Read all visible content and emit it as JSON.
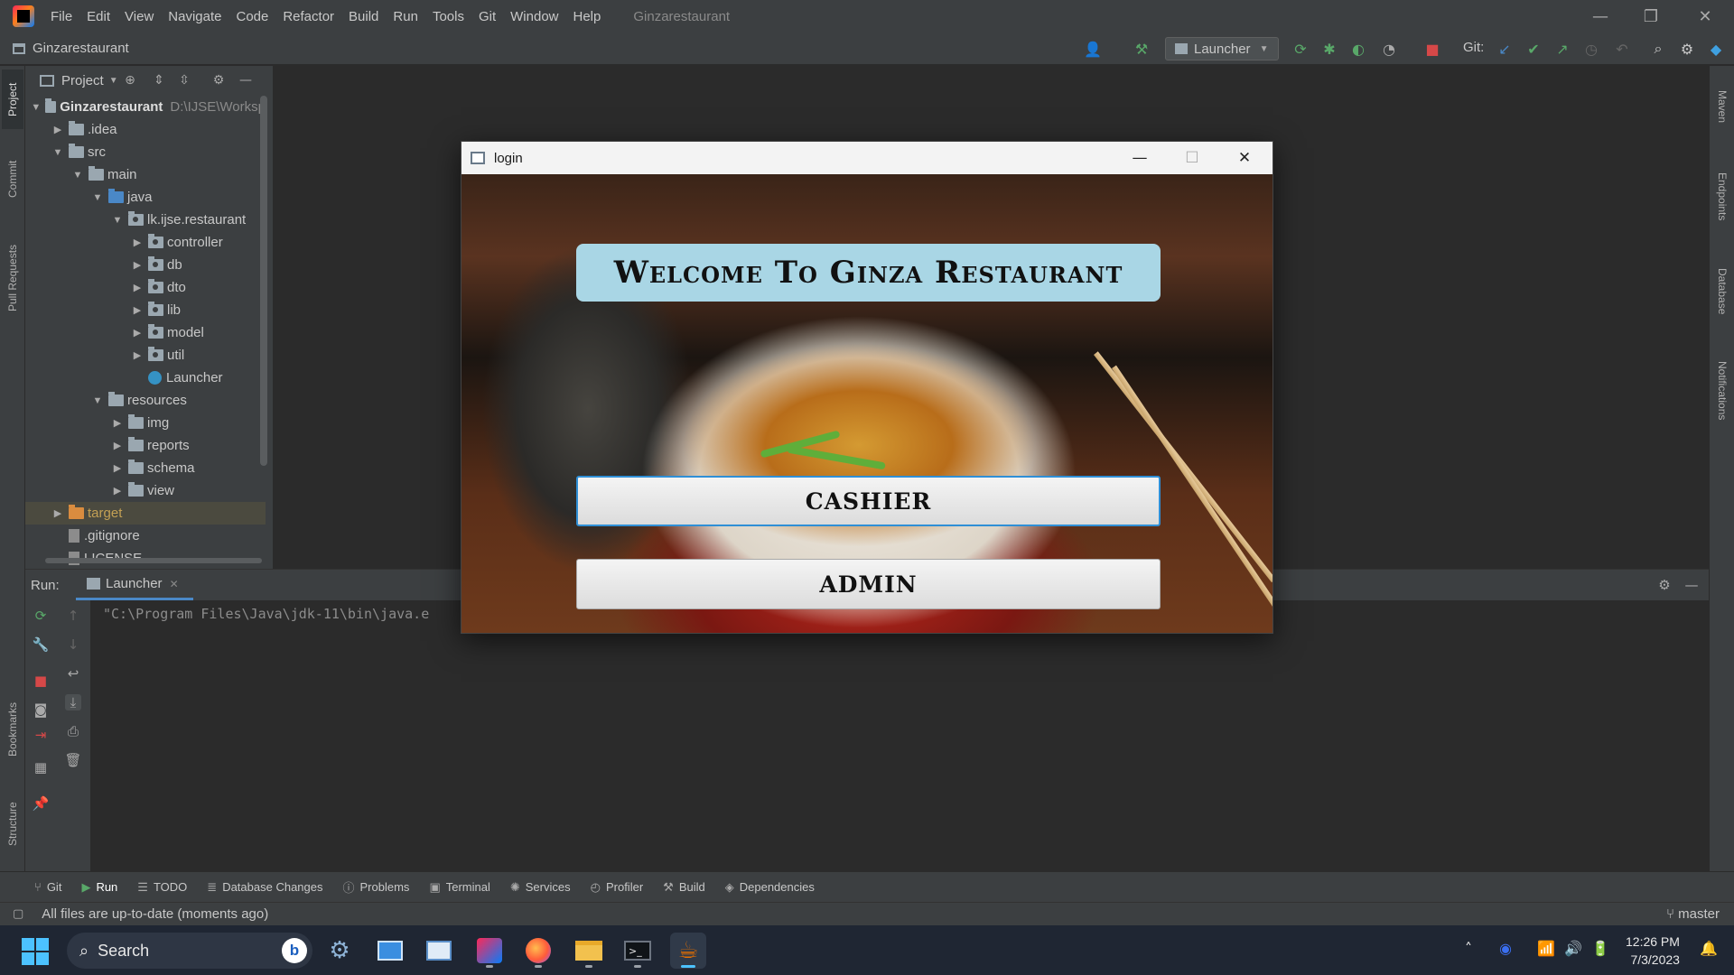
{
  "ide": {
    "menu": [
      "File",
      "Edit",
      "View",
      "Navigate",
      "Code",
      "Refactor",
      "Build",
      "Run",
      "Tools",
      "Git",
      "Window",
      "Help"
    ],
    "window_title": "Ginzarestaurant",
    "project_name": "Ginzarestaurant",
    "run_config": "Launcher",
    "git_label": "Git:"
  },
  "left_stripe": [
    "Project",
    "Commit",
    "Pull Requests",
    "Bookmarks",
    "Structure"
  ],
  "right_stripe": [
    "Maven",
    "Endpoints",
    "Database",
    "Notifications"
  ],
  "project_panel": {
    "title": "Project",
    "tree": [
      {
        "label": "Ginzarestaurant",
        "path": "D:\\IJSE\\Worksp",
        "bold": true
      },
      {
        "label": ".idea"
      },
      {
        "label": "src"
      },
      {
        "label": "main"
      },
      {
        "label": "java"
      },
      {
        "label": "lk.ijse.restaurant"
      },
      {
        "label": "controller"
      },
      {
        "label": "db"
      },
      {
        "label": "dto"
      },
      {
        "label": "lib"
      },
      {
        "label": "model"
      },
      {
        "label": "util"
      },
      {
        "label": "Launcher"
      },
      {
        "label": "resources"
      },
      {
        "label": "img"
      },
      {
        "label": "reports"
      },
      {
        "label": "schema"
      },
      {
        "label": "view"
      },
      {
        "label": "target"
      },
      {
        "label": ".gitignore"
      },
      {
        "label": "LICENSE"
      }
    ]
  },
  "run_panel": {
    "label": "Run:",
    "tab": "Launcher",
    "console_line": "\"C:\\Program Files\\Java\\jdk-11\\bin\\java.e"
  },
  "bottom_tools": [
    {
      "label": "Git",
      "icon": "git-branch-icon"
    },
    {
      "label": "Run",
      "icon": "run-icon",
      "active": true
    },
    {
      "label": "TODO",
      "icon": "list-icon"
    },
    {
      "label": "Database Changes",
      "icon": "database-icon"
    },
    {
      "label": "Problems",
      "icon": "problems-icon"
    },
    {
      "label": "Terminal",
      "icon": "terminal-icon"
    },
    {
      "label": "Services",
      "icon": "services-icon"
    },
    {
      "label": "Profiler",
      "icon": "profiler-icon"
    },
    {
      "label": "Build",
      "icon": "hammer-icon"
    },
    {
      "label": "Dependencies",
      "icon": "dependencies-icon"
    }
  ],
  "status": {
    "text": "All files are up-to-date (moments ago)",
    "branch": "master"
  },
  "login": {
    "title": "login",
    "welcome": "Welcome To Ginza Restaurant",
    "cashier_label": "CASHIER",
    "admin_label": "ADMIN"
  },
  "taskbar": {
    "search_placeholder": "Search",
    "bing": "b",
    "time": "12:26 PM",
    "date": "7/3/2023"
  },
  "colors": {
    "ide_bg": "#2b2b2b",
    "panel_bg": "#3c3f41",
    "banner_bg": "#a9d6e5",
    "focus_border": "#2f8fd6",
    "taskbar_bg": "#1f2633"
  }
}
